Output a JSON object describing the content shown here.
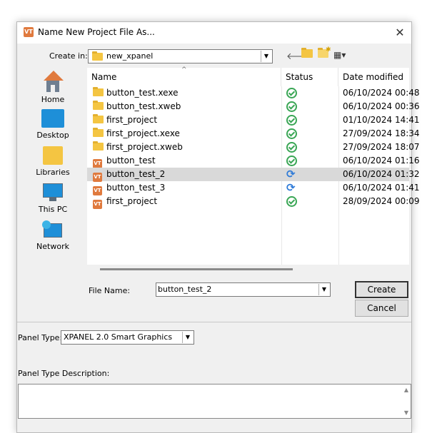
{
  "dialog": {
    "title": "Name New Project File As...",
    "app_icon_text": "VT"
  },
  "create_in": {
    "label": "Create in:",
    "value": "new_xpanel"
  },
  "places": [
    {
      "label": "Home",
      "icon": "home-icon"
    },
    {
      "label": "Desktop",
      "icon": "desktop-icon"
    },
    {
      "label": "Libraries",
      "icon": "libraries-icon"
    },
    {
      "label": "This PC",
      "icon": "this-pc-icon"
    },
    {
      "label": "Network",
      "icon": "network-icon"
    }
  ],
  "columns": {
    "name": "Name",
    "status": "Status",
    "date": "Date modified"
  },
  "files": [
    {
      "name": "button_test.xexe",
      "type": "folder",
      "status": "ok",
      "date": "06/10/2024 00:48"
    },
    {
      "name": "button_test.xweb",
      "type": "folder",
      "status": "ok",
      "date": "06/10/2024 00:36"
    },
    {
      "name": "first_project",
      "type": "folder",
      "status": "ok",
      "date": "01/10/2024 14:41"
    },
    {
      "name": "first_project.xexe",
      "type": "folder",
      "status": "ok",
      "date": "27/09/2024 18:34"
    },
    {
      "name": "first_project.xweb",
      "type": "folder",
      "status": "ok",
      "date": "27/09/2024 18:07"
    },
    {
      "name": "button_test",
      "type": "vt",
      "status": "ok",
      "date": "06/10/2024 01:16"
    },
    {
      "name": "button_test_2",
      "type": "vt",
      "status": "sync",
      "date": "06/10/2024 01:32",
      "selected": true
    },
    {
      "name": "button_test_3",
      "type": "vt",
      "status": "sync",
      "date": "06/10/2024 01:41"
    },
    {
      "name": "first_project",
      "type": "vt",
      "status": "ok",
      "date": "28/09/2024 00:09"
    }
  ],
  "file_name": {
    "label": "File Name:",
    "value": "button_test_2"
  },
  "buttons": {
    "create": "Create",
    "cancel": "Cancel"
  },
  "panel_type": {
    "label": "Panel Type:",
    "value": "XPANEL 2.0 Smart Graphics"
  },
  "panel_desc": {
    "label": "Panel Type Description:"
  },
  "colors": {
    "accent_orange": "#e07a3e",
    "folder_yellow": "#f4c542",
    "status_green": "#3aa655",
    "status_blue": "#2f7bd8"
  }
}
